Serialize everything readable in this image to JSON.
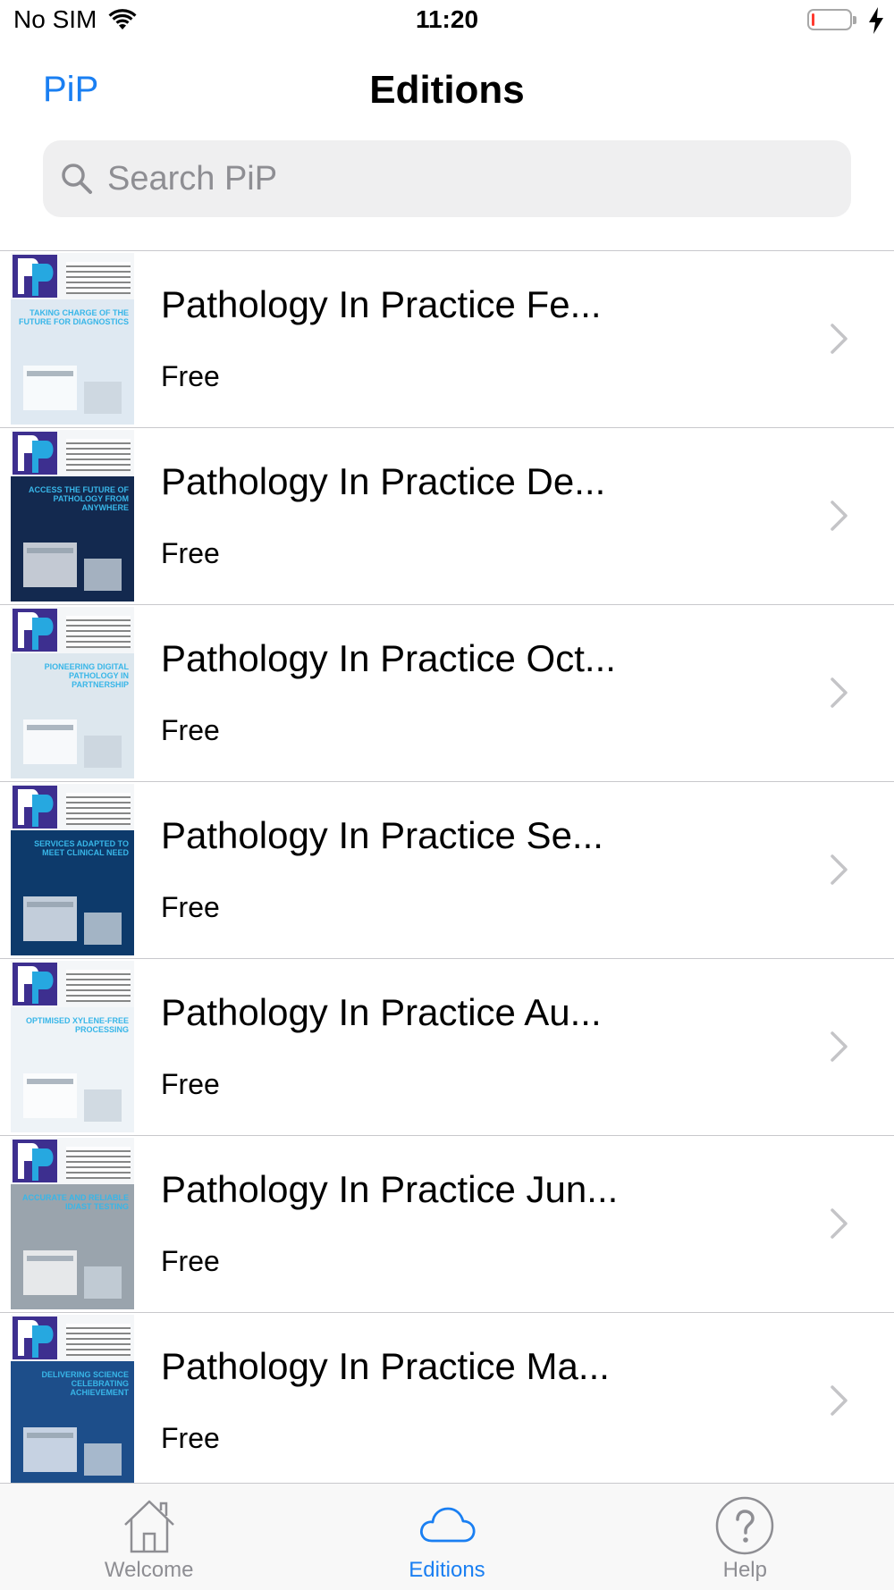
{
  "status_bar": {
    "carrier": "No SIM",
    "time": "11:20",
    "battery_level": 0.05
  },
  "nav": {
    "back_label": "PiP",
    "title": "Editions"
  },
  "search": {
    "placeholder": "Search PiP"
  },
  "editions": [
    {
      "title": "Pathology In Practice Fe...",
      "price": "Free",
      "cover_headline": "TAKING CHARGE OF THE FUTURE FOR DIAGNOSTICS",
      "cover_color": "#dfe9f2"
    },
    {
      "title": "Pathology In Practice De...",
      "price": "Free",
      "cover_headline": "ACCESS THE FUTURE OF PATHOLOGY FROM ANYWHERE",
      "cover_color": "#13294f"
    },
    {
      "title": "Pathology In Practice Oct...",
      "price": "Free",
      "cover_headline": "PIONEERING DIGITAL PATHOLOGY IN PARTNERSHIP",
      "cover_color": "#dde7ee"
    },
    {
      "title": "Pathology In Practice Se...",
      "price": "Free",
      "cover_headline": "SERVICES ADAPTED TO MEET CLINICAL NEED",
      "cover_color": "#0d3a6b"
    },
    {
      "title": "Pathology In Practice Au...",
      "price": "Free",
      "cover_headline": "OPTIMISED XYLENE-FREE PROCESSING",
      "cover_color": "#eef3f7"
    },
    {
      "title": "Pathology In Practice Jun...",
      "price": "Free",
      "cover_headline": "ACCURATE AND RELIABLE ID/AST TESTING",
      "cover_color": "#9aa4ad"
    },
    {
      "title": "Pathology In Practice Ma...",
      "price": "Free",
      "cover_headline": "DELIVERING SCIENCE CELEBRATING ACHIEVEMENT",
      "cover_color": "#1d4e8a"
    }
  ],
  "tabs": [
    {
      "label": "Welcome",
      "icon": "house-icon",
      "active": false
    },
    {
      "label": "Editions",
      "icon": "cloud-icon",
      "active": true
    },
    {
      "label": "Help",
      "icon": "question-icon",
      "active": false
    }
  ],
  "colors": {
    "accent": "#1a7ff2",
    "inactive_tab": "#8e8e93",
    "separator": "#c8c8cc",
    "battery_low": "#ff3b30"
  }
}
